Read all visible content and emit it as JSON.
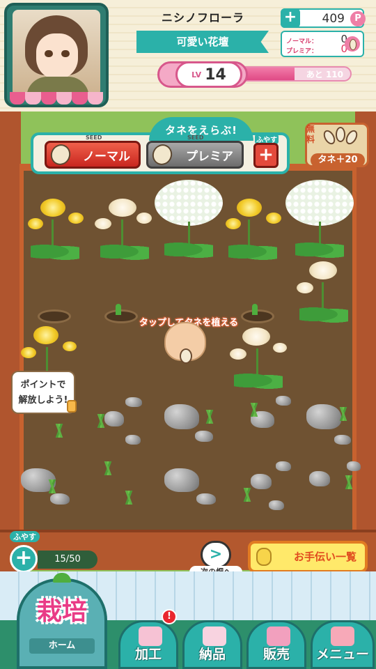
{
  "player": {
    "name": "ニシノフローラ",
    "title": "可愛い花壇",
    "level_prefix": "LV",
    "level": "14",
    "level_remaining": "あと 110",
    "level_progress": 0.6
  },
  "currency": {
    "points": "409",
    "points_icon": "P",
    "add_icon": "+",
    "normal_seeds_label": "ノーマル：",
    "normal_seeds": "0",
    "premium_seeds_label": "プレミア：",
    "premium_seeds": "0"
  },
  "seed_panel": {
    "title": "タネをえらぶ!",
    "seed_tag": "SEED",
    "normal_label": "ノーマル",
    "premium_label": "プレミア",
    "add_label": "ふやす",
    "add_icon": "+"
  },
  "free_seed": {
    "label": "無料",
    "bonus": "タネ＋20"
  },
  "field": {
    "tap_hint": "タップしてタネを植える",
    "unlock_hint_line1": "ポイントで",
    "unlock_hint_line2": "解放しよう!"
  },
  "controls": {
    "expand_label": "ふやす",
    "expand_icon": "+",
    "field_count": "15/50",
    "next_field_icon": ">",
    "next_field_label": "次の畑へ",
    "helpers_label": "お手伝い一覧"
  },
  "nav": {
    "cultivate": "栽培",
    "home": "ホーム",
    "process": "加工",
    "process_alert": "!",
    "deliver": "納品",
    "sell": "販売",
    "menu": "メニュー"
  },
  "colors": {
    "accent_teal": "#2bb1a9",
    "pink": "#e93b86",
    "soil": "#6f5232"
  }
}
